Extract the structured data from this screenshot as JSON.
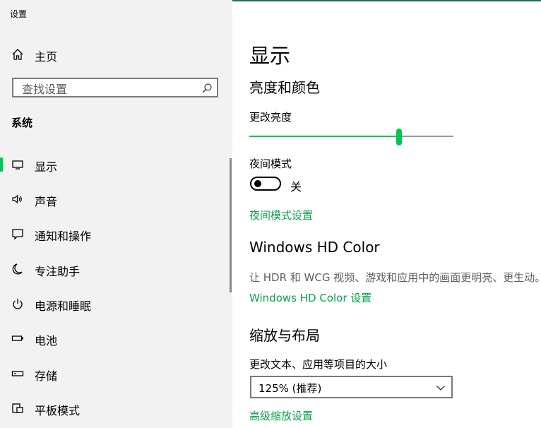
{
  "window": {
    "title": "设置"
  },
  "sidebar": {
    "home_label": "主页",
    "search_placeholder": "查找设置",
    "section": "系统",
    "items": [
      {
        "label": "显示",
        "icon": "monitor-icon",
        "selected": true
      },
      {
        "label": "声音",
        "icon": "speaker-icon",
        "selected": false
      },
      {
        "label": "通知和操作",
        "icon": "notification-icon",
        "selected": false
      },
      {
        "label": "专注助手",
        "icon": "moon-icon",
        "selected": false
      },
      {
        "label": "电源和睡眠",
        "icon": "power-icon",
        "selected": false
      },
      {
        "label": "电池",
        "icon": "battery-icon",
        "selected": false
      },
      {
        "label": "存储",
        "icon": "storage-icon",
        "selected": false
      },
      {
        "label": "平板模式",
        "icon": "tablet-mode-icon",
        "selected": false
      }
    ]
  },
  "main": {
    "page_title": "显示",
    "brightness_section": "亮度和颜色",
    "brightness_label": "更改亮度",
    "brightness_value": 0.74,
    "night_light_label": "夜间模式",
    "night_light_state": "关",
    "night_light_settings_link": "夜间模式设置",
    "hdr_section": "Windows HD Color",
    "hdr_description": "让 HDR 和 WCG 视频、游戏和应用中的画面更明亮、更生动。",
    "hdr_link": "Windows HD Color 设置",
    "scale_section": "缩放与布局",
    "scale_label": "更改文本、应用等项目的大小",
    "scale_value": "125% (推荐)",
    "advanced_scaling_link": "高级缩放设置"
  },
  "colors": {
    "accent": "#00c850",
    "link": "#06a44a",
    "sidebar_bg": "#f2f2f2"
  }
}
